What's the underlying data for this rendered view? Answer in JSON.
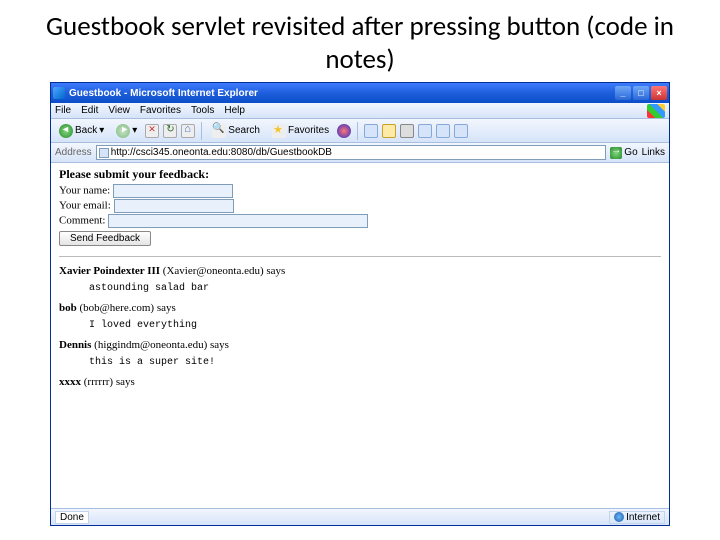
{
  "slide": {
    "title": "Guestbook servlet revisited after pressing button (code in notes)"
  },
  "window": {
    "title": "Guestbook - Microsoft Internet Explorer",
    "menu": {
      "file": "File",
      "edit": "Edit",
      "view": "View",
      "favorites": "Favorites",
      "tools": "Tools",
      "help": "Help"
    },
    "toolbar": {
      "back": "Back",
      "search": "Search",
      "favorites": "Favorites"
    },
    "address": {
      "label": "Address",
      "url": "http://csci345.oneonta.edu:8080/db/GuestbookDB",
      "go": "Go",
      "links": "Links"
    },
    "status": {
      "done": "Done",
      "zone": "Internet"
    }
  },
  "form": {
    "heading": "Please submit your feedback:",
    "name_label": "Your name:",
    "email_label": "Your email:",
    "comment_label": "Comment:",
    "submit": "Send Feedback"
  },
  "entries": [
    {
      "name": "Xavier Poindexter III",
      "email": "Xavier@oneonta.edu",
      "says": "says",
      "msg": "astounding salad bar"
    },
    {
      "name": "bob",
      "email": "bob@here.com",
      "says": "says",
      "msg": "I loved everything"
    },
    {
      "name": "Dennis",
      "email": "higgindm@oneonta.edu",
      "says": "says",
      "msg": "this is a super site!"
    },
    {
      "name": "xxxx",
      "email": "rrrrrr",
      "says": "says",
      "msg": ""
    }
  ]
}
